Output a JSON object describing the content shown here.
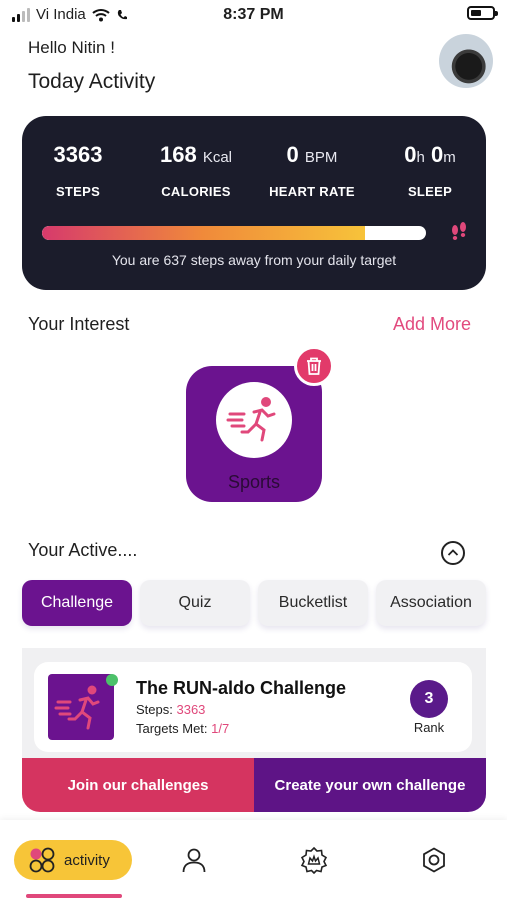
{
  "status_bar": {
    "carrier": "Vi India",
    "time": "8:37 PM"
  },
  "header": {
    "greeting": "Hello Nitin !",
    "title": "Today Activity"
  },
  "stats": {
    "steps": {
      "value": "3363",
      "label": "STEPS"
    },
    "calories": {
      "value": "168",
      "unit": "Kcal",
      "label": "CALORIES"
    },
    "heart_rate": {
      "value": "0",
      "unit": "BPM",
      "label": "HEART RATE"
    },
    "sleep": {
      "hours": "0",
      "hours_unit": "h",
      "minutes": "0",
      "minutes_unit": "m",
      "label": "SLEEP"
    },
    "progress_percent": 84,
    "message": "You are 637 steps away from your daily target"
  },
  "interest": {
    "title": "Your Interest",
    "add_more": "Add More",
    "items": [
      {
        "label": "Sports",
        "icon": "runner-icon"
      }
    ]
  },
  "active": {
    "title": "Your Active....",
    "tabs": [
      {
        "label": "Challenge",
        "active": true
      },
      {
        "label": "Quiz",
        "active": false
      },
      {
        "label": "Bucketlist",
        "active": false
      },
      {
        "label": "Association",
        "active": false
      }
    ],
    "challenge": {
      "title": "The RUN-aldo Challenge",
      "steps_label": "Steps:",
      "steps_value": "3363",
      "targets_label": "Targets Met:",
      "targets_value": "1/7",
      "rank": "3",
      "rank_label": "Rank"
    },
    "join_label": "Join our challenges",
    "create_label": "Create your own challenge"
  },
  "bottom_nav": {
    "active_label": "activity",
    "items": [
      "activity-icon",
      "profile-icon",
      "badge-icon",
      "settings-icon"
    ]
  },
  "colors": {
    "primary_purple": "#6b138f",
    "accent_pink": "#e0487b",
    "card_dark": "#1b1c2b",
    "nav_yellow": "#f7c538"
  }
}
